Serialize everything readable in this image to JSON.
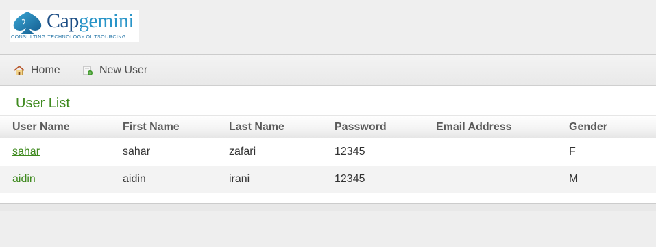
{
  "brand": {
    "name_part1": "Cap",
    "name_part2": "gemini",
    "tagline": "CONSULTING.TECHNOLOGY.OUTSOURCING",
    "colors": {
      "primary": "#1e4f86",
      "secondary": "#2a95c8"
    }
  },
  "nav": {
    "items": [
      {
        "label": "Home",
        "icon": "home-icon"
      },
      {
        "label": "New User",
        "icon": "add-user-icon"
      }
    ]
  },
  "user_list": {
    "title": "User List",
    "columns": [
      "User Name",
      "First Name",
      "Last Name",
      "Password",
      "Email Address",
      "Gender"
    ],
    "rows": [
      {
        "user_name": "sahar",
        "first_name": "sahar",
        "last_name": "zafari",
        "password": "12345",
        "email": "",
        "gender": "F"
      },
      {
        "user_name": "aidin",
        "first_name": "aidin",
        "last_name": "irani",
        "password": "12345",
        "email": "",
        "gender": "M"
      }
    ]
  },
  "colors": {
    "accent": "#3f8a1f",
    "header_bg": "#efefef",
    "row_alt": "#f3f3f3"
  }
}
